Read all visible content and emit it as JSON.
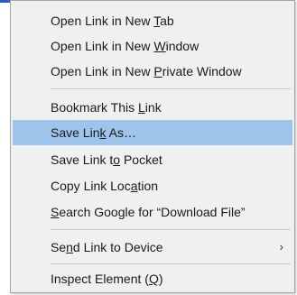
{
  "context_menu": {
    "items": [
      {
        "pre": "Open Link in New ",
        "key": "T",
        "post": "ab"
      },
      {
        "pre": "Open Link in New ",
        "key": "W",
        "post": "indow"
      },
      {
        "pre": "Open Link in New ",
        "key": "P",
        "post": "rivate Window"
      },
      {
        "pre": "Bookmark This ",
        "key": "L",
        "post": "ink"
      },
      {
        "pre": "Save Lin",
        "key": "k",
        "post": " As…"
      },
      {
        "pre": "Save Link t",
        "key": "o",
        "post": " Pocket"
      },
      {
        "pre": "Copy Link Loc",
        "key": "a",
        "post": "tion"
      },
      {
        "pre": "",
        "key": "S",
        "post": "earch Google for “Download File”"
      },
      {
        "pre": "Se",
        "key": "n",
        "post": "d Link to Device"
      },
      {
        "pre": "Inspect Element (",
        "key": "Q",
        "post": ")"
      }
    ],
    "submenu_arrow": "›",
    "highlighted_item": "Save Link As…"
  },
  "colors": {
    "menu_background": "#f0f0f0",
    "highlight": "#9ec4ec",
    "separator": "#c8c8c8"
  }
}
